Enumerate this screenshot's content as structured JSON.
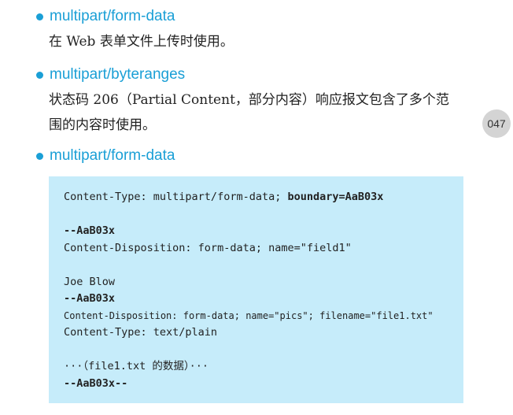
{
  "items": [
    {
      "title": "multipart/form-data",
      "desc": [
        "在 Web 表单文件上传时使用。"
      ]
    },
    {
      "title": "multipart/byteranges",
      "desc": [
        "状态码 206（Partial Content，部分内容）响应报文包含了多个范",
        "围的内容时使用。"
      ]
    },
    {
      "title": "multipart/form-data"
    }
  ],
  "page_number": "047",
  "code": {
    "line1_prefix": "Content-Type: multipart/form-data; ",
    "line1_bold": "boundary=AaB03x",
    "boundary1": "--AaB03x",
    "disposition1": "Content-Disposition: form-data; name=\"field1\"",
    "value1": "Joe Blow",
    "boundary2": "--AaB03x",
    "disposition2": "Content-Disposition: form-data; name=\"pics\"; filename=\"file1.txt\"",
    "content_type2": "Content-Type: text/plain",
    "file_placeholder": "···（file1.txt 的数据）···",
    "boundary_end": "--AaB03x--"
  },
  "colors": {
    "accent": "#1a9fd6",
    "code_background": "#c6ecfa",
    "badge_background": "#d4d4d4"
  }
}
